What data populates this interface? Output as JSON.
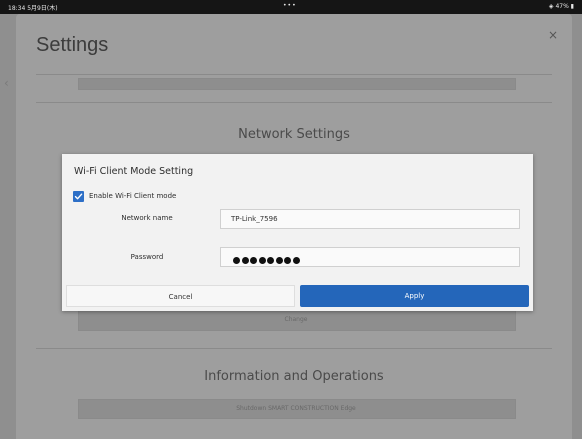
{
  "status_bar": {
    "time": "18:34",
    "date": "5月9日(木)",
    "center": "•••",
    "right": "◈ 47% ▮"
  },
  "settings": {
    "title": "Settings",
    "close_icon": "close-icon",
    "sections": {
      "network_heading": "Network Settings",
      "network_change_button": "Change",
      "info_heading": "Information and Operations",
      "shutdown_button": "Shutdown SMART CONSTRUCTION Edge"
    }
  },
  "dialog": {
    "title": "Wi-Fi Client Mode Setting",
    "enable_checkbox": {
      "label": "Enable Wi-Fi Client mode",
      "checked": true
    },
    "network_name": {
      "label": "Network name",
      "value": "TP-Link_7596"
    },
    "password": {
      "label": "Password",
      "masked_length": 8
    },
    "cancel_label": "Cancel",
    "apply_label": "Apply"
  },
  "colors": {
    "accent": "#2466ba",
    "checkbox": "#2d6fc7",
    "dialog_bg": "#f2f2f2",
    "overlay_bg": "#9e9e9e"
  }
}
